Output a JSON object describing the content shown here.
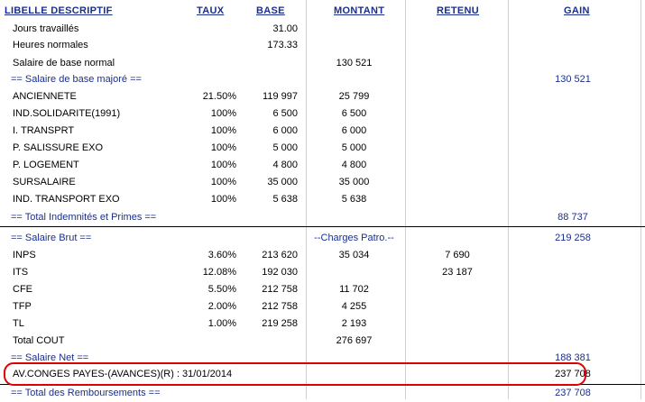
{
  "headers": {
    "libelle": "LIBELLE DESCRIPTIF",
    "taux": "TAUX",
    "base": "BASE",
    "montant": "MONTANT",
    "retenu": "RETENU",
    "gain": "GAIN"
  },
  "rows": [
    {
      "libelle": "Jours travaillés",
      "taux": "",
      "base": "31.00",
      "montant": "",
      "retenu": "",
      "gain": ""
    },
    {
      "libelle": "Heures normales",
      "taux": "",
      "base": "173.33",
      "montant": "",
      "retenu": "",
      "gain": ""
    },
    {
      "libelle": "Salaire de base normal",
      "taux": "",
      "base": "",
      "montant": "130 521",
      "retenu": "",
      "gain": ""
    },
    {
      "libelle": "== Salaire de base majoré ==",
      "taux": "",
      "base": "",
      "montant": "",
      "retenu": "",
      "gain": "130 521"
    },
    {
      "libelle": "ANCIENNETE",
      "taux": "21.50%",
      "base": "119 997",
      "montant": "25 799",
      "retenu": "",
      "gain": ""
    },
    {
      "libelle": "IND.SOLIDARITE(1991)",
      "taux": "100%",
      "base": "6 500",
      "montant": "6 500",
      "retenu": "",
      "gain": ""
    },
    {
      "libelle": "I. TRANSPRT",
      "taux": "100%",
      "base": "6 000",
      "montant": "6 000",
      "retenu": "",
      "gain": ""
    },
    {
      "libelle": "P. SALISSURE EXO",
      "taux": "100%",
      "base": "5 000",
      "montant": "5 000",
      "retenu": "",
      "gain": ""
    },
    {
      "libelle": "P. LOGEMENT",
      "taux": "100%",
      "base": "4 800",
      "montant": "4 800",
      "retenu": "",
      "gain": ""
    },
    {
      "libelle": "SURSALAIRE",
      "taux": "100%",
      "base": "35 000",
      "montant": "35 000",
      "retenu": "",
      "gain": ""
    },
    {
      "libelle": "IND. TRANSPORT EXO",
      "taux": "100%",
      "base": "5 638",
      "montant": "5 638",
      "retenu": "",
      "gain": ""
    },
    {
      "libelle": "== Total Indemnités et Primes ==",
      "taux": "",
      "base": "",
      "montant": "",
      "retenu": "",
      "gain": "88 737"
    },
    {
      "libelle": "== Salaire Brut ==",
      "taux": "",
      "base": "",
      "montant": "--Charges Patro.--",
      "retenu": "",
      "gain": "219 258"
    },
    {
      "libelle": "INPS",
      "taux": "3.60%",
      "base": "213 620",
      "montant": "35 034",
      "retenu": "7 690",
      "gain": ""
    },
    {
      "libelle": "ITS",
      "taux": "12.08%",
      "base": "192 030",
      "montant": "",
      "retenu": "23 187",
      "gain": ""
    },
    {
      "libelle": "CFE",
      "taux": "5.50%",
      "base": "212 758",
      "montant": "11 702",
      "retenu": "",
      "gain": ""
    },
    {
      "libelle": "TFP",
      "taux": "2.00%",
      "base": "212 758",
      "montant": "4 255",
      "retenu": "",
      "gain": ""
    },
    {
      "libelle": "TL",
      "taux": "1.00%",
      "base": "219 258",
      "montant": "2 193",
      "retenu": "",
      "gain": ""
    },
    {
      "libelle": "Total COUT",
      "taux": "",
      "base": "",
      "montant": "276 697",
      "retenu": "",
      "gain": ""
    },
    {
      "libelle": "== Salaire Net ==",
      "taux": "",
      "base": "",
      "montant": "",
      "retenu": "",
      "gain": "188 381"
    },
    {
      "libelle": "AV.CONGES PAYES-(AVANCES)(R)    : 31/01/2014",
      "taux": "",
      "base": "",
      "montant": "",
      "retenu": "",
      "gain": "237 708"
    },
    {
      "libelle": "== Total des Remboursements ==",
      "taux": "",
      "base": "",
      "montant": "",
      "retenu": "",
      "gain": "237 708"
    }
  ]
}
